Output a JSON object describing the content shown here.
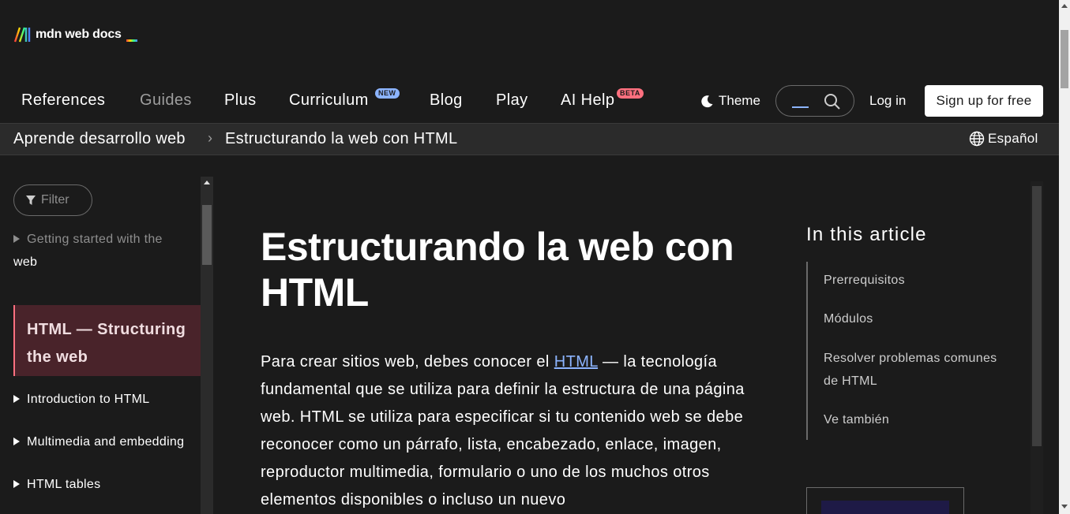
{
  "header": {
    "logo_text": "mdn web docs"
  },
  "nav": {
    "items": [
      {
        "label": "References"
      },
      {
        "label": "Guides"
      },
      {
        "label": "Plus"
      },
      {
        "label": "Curriculum",
        "badge": "NEW"
      },
      {
        "label": "Blog"
      },
      {
        "label": "Play"
      },
      {
        "label": "AI Help",
        "badge": "BETA"
      }
    ],
    "theme_label": "Theme",
    "login_label": "Log in",
    "signup_label": "Sign up for free"
  },
  "breadcrumb": {
    "items": [
      "Aprende desarrollo web",
      "Estructurando la web con HTML"
    ],
    "separator": "›",
    "language": "Español"
  },
  "sidebar": {
    "filter_placeholder": "Filter",
    "items": [
      {
        "label": "Getting started with the",
        "label2": "web"
      },
      {
        "label": "HTML — Structuring",
        "label2": "the web",
        "active": true
      },
      {
        "label": "Introduction to HTML"
      },
      {
        "label": "Multimedia and embedding"
      },
      {
        "label": "HTML tables"
      }
    ]
  },
  "main": {
    "title_line1": "Estructurando la web con",
    "title_line2": "HTML",
    "para_before": "Para crear sitios web, debes conocer el ",
    "para_link": "HTML",
    "para_after": " — la tecnología fundamental que se utiliza para definir la estructura de una página web. HTML se utiliza para especificar si tu contenido web se debe reconocer como un párrafo, lista, encabezado, enlace, imagen, reproductor multimedia, formulario o uno de los muchos otros elementos disponibles o incluso un nuevo"
  },
  "toc": {
    "title": "In this article",
    "items": [
      {
        "label": "Prerrequisitos"
      },
      {
        "label": "Módulos"
      },
      {
        "label": "Resolver problemas comunes",
        "label2": "de HTML"
      },
      {
        "label": "Ve también"
      }
    ]
  },
  "colors": {
    "background": "#1b1b1b",
    "link": "#8cb4ff",
    "active_item_bg": "#49232a",
    "active_item_border": "#ff707f"
  }
}
